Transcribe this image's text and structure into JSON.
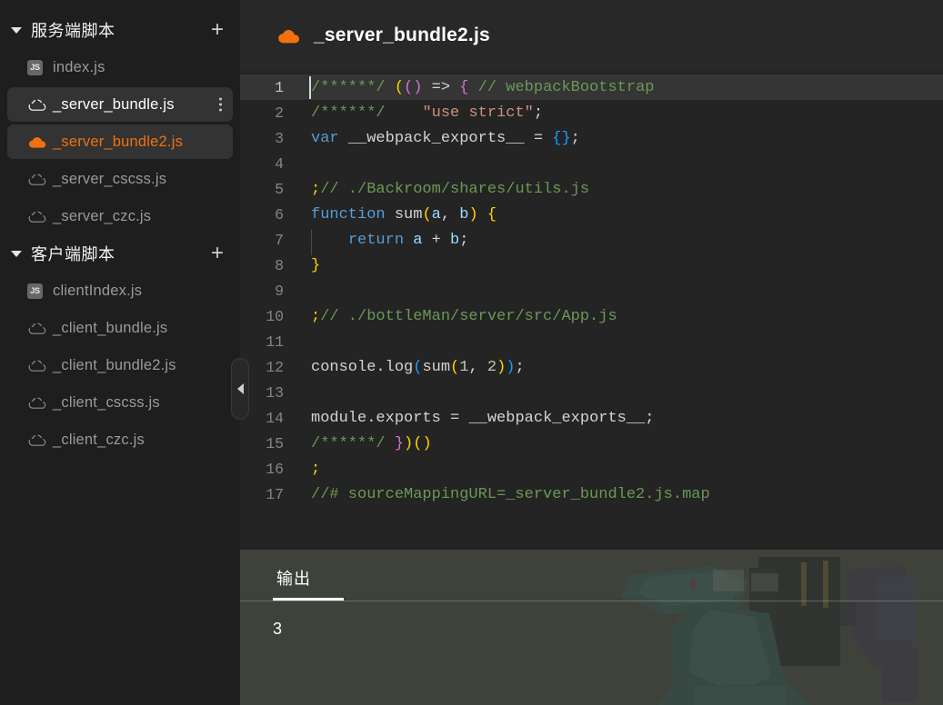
{
  "sidebar": {
    "sections": [
      {
        "title": "服务端脚本",
        "caret": "caret-down-icon",
        "add_label": "+",
        "files": [
          {
            "name": "index.js",
            "icon": "js-file-icon",
            "state": "normal"
          },
          {
            "name": "_server_bundle.js",
            "icon": "cloud-outline-icon",
            "state": "selected",
            "menu": "more-options-icon"
          },
          {
            "name": "_server_bundle2.js",
            "icon": "cloud-filled-icon",
            "state": "active"
          },
          {
            "name": "_server_cscss.js",
            "icon": "cloud-outline-icon",
            "state": "normal"
          },
          {
            "name": "_server_czc.js",
            "icon": "cloud-outline-icon",
            "state": "normal"
          }
        ]
      },
      {
        "title": "客户端脚本",
        "caret": "caret-down-icon",
        "add_label": "+",
        "files": [
          {
            "name": "clientIndex.js",
            "icon": "js-file-icon",
            "state": "normal"
          },
          {
            "name": "_client_bundle.js",
            "icon": "cloud-outline-icon",
            "state": "normal"
          },
          {
            "name": "_client_bundle2.js",
            "icon": "cloud-outline-icon",
            "state": "normal"
          },
          {
            "name": "_client_cscss.js",
            "icon": "cloud-outline-icon",
            "state": "normal"
          },
          {
            "name": "_client_czc.js",
            "icon": "cloud-outline-icon",
            "state": "normal"
          }
        ]
      }
    ],
    "collapse_handle": "collapse-sidebar-icon"
  },
  "editor": {
    "file_icon": "cloud-filled-icon",
    "file_title": "_server_bundle2.js",
    "active_line": 1,
    "lines": [
      {
        "n": "1",
        "text": "/******/ (() => { // webpackBootstrap"
      },
      {
        "n": "2",
        "text": "/******/    \"use strict\";"
      },
      {
        "n": "3",
        "text": "var __webpack_exports__ = {};"
      },
      {
        "n": "4",
        "text": ""
      },
      {
        "n": "5",
        "text": ";// ./Backroom/shares/utils.js"
      },
      {
        "n": "6",
        "text": "function sum(a, b) {"
      },
      {
        "n": "7",
        "text": "    return a + b;"
      },
      {
        "n": "8",
        "text": "}"
      },
      {
        "n": "9",
        "text": ""
      },
      {
        "n": "10",
        "text": ";// ./bottleMan/server/src/App.js"
      },
      {
        "n": "11",
        "text": ""
      },
      {
        "n": "12",
        "text": "console.log(sum(1, 2));"
      },
      {
        "n": "13",
        "text": ""
      },
      {
        "n": "14",
        "text": "module.exports = __webpack_exports__;"
      },
      {
        "n": "15",
        "text": "/******/ })()"
      },
      {
        "n": "16",
        "text": ";"
      },
      {
        "n": "17",
        "text": "//# sourceMappingURL=_server_bundle2.js.map"
      }
    ]
  },
  "output": {
    "tabs": [
      {
        "label": "输出",
        "active": true
      }
    ],
    "content": "3"
  },
  "colors": {
    "accent_orange": "#f2700d",
    "sidebar_bg": "#1e1e1e",
    "editor_bg": "#242424",
    "header_bg": "#282828",
    "active_line": "#353535",
    "output_bg": "#3e423b",
    "comment_green": "#6a9955",
    "keyword_blue": "#569cd6",
    "string_orange": "#ce9178",
    "function_yellow": "#dcdcaa",
    "variable_blue": "#9cdcfe"
  }
}
